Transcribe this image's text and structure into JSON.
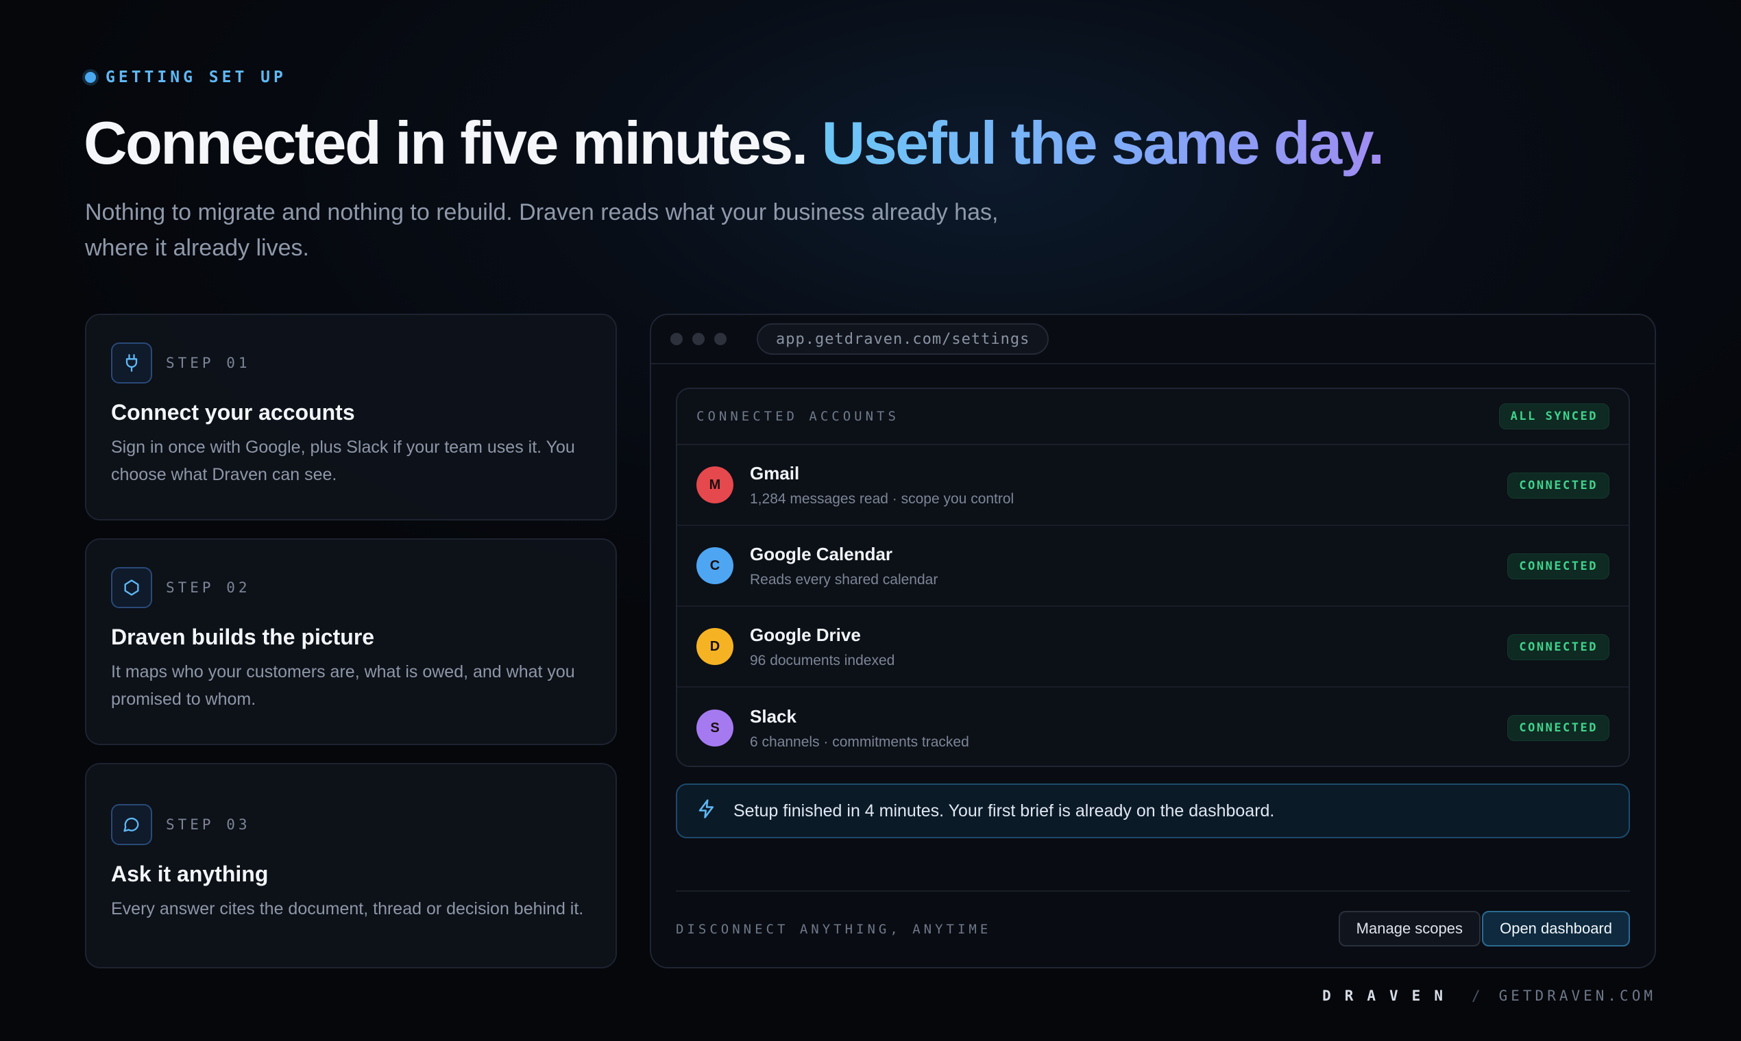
{
  "header": {
    "eyebrow": "GETTING SET UP",
    "headline_main": "Connected in five minutes. ",
    "headline_accent": "Useful the same day.",
    "subhead": "Nothing to migrate and nothing to rebuild. Draven reads what your business already has, where it already lives."
  },
  "steps": [
    {
      "label": "STEP 01",
      "title": "Connect your accounts",
      "desc": "Sign in once with Google, plus Slack if your team uses it. You choose what Draven can see.",
      "icon": "plug-icon"
    },
    {
      "label": "STEP 02",
      "title": "Draven builds the picture",
      "desc": "It maps who your customers are, what is owed, and what you promised to whom.",
      "icon": "hexagon-icon"
    },
    {
      "label": "STEP 03",
      "title": "Ask it anything",
      "desc": "Every answer cites the document, thread or decision behind it.",
      "icon": "chat-bubble-icon"
    }
  ],
  "window": {
    "url": "app.getdraven.com/settings",
    "accounts_title": "CONNECTED ACCOUNTS",
    "all_synced": "ALL SYNCED",
    "accounts": [
      {
        "initial": "M",
        "name": "Gmail",
        "detail": "1,284 messages read · scope you control",
        "status": "CONNECTED",
        "color": "#e5484d"
      },
      {
        "initial": "C",
        "name": "Google Calendar",
        "detail": "Reads every shared calendar",
        "status": "CONNECTED",
        "color": "#4ea5f2"
      },
      {
        "initial": "D",
        "name": "Google Drive",
        "detail": "96 documents indexed",
        "status": "CONNECTED",
        "color": "#f5b324"
      },
      {
        "initial": "S",
        "name": "Slack",
        "detail": "6 channels · commitments tracked",
        "status": "CONNECTED",
        "color": "#a57af0"
      }
    ],
    "notice": "Setup finished in 4 minutes. Your first brief is already on the dashboard.",
    "footer_note": "DISCONNECT ANYTHING, ANYTIME",
    "manage_label": "Manage scopes",
    "open_label": "Open dashboard"
  },
  "brand": {
    "wordmark": "DRAVEN",
    "separator": "/",
    "domain": "GETDRAVEN.COM"
  },
  "colors": {
    "accent_blue": "#5fb8f5",
    "connected_green": "#41d38d"
  }
}
